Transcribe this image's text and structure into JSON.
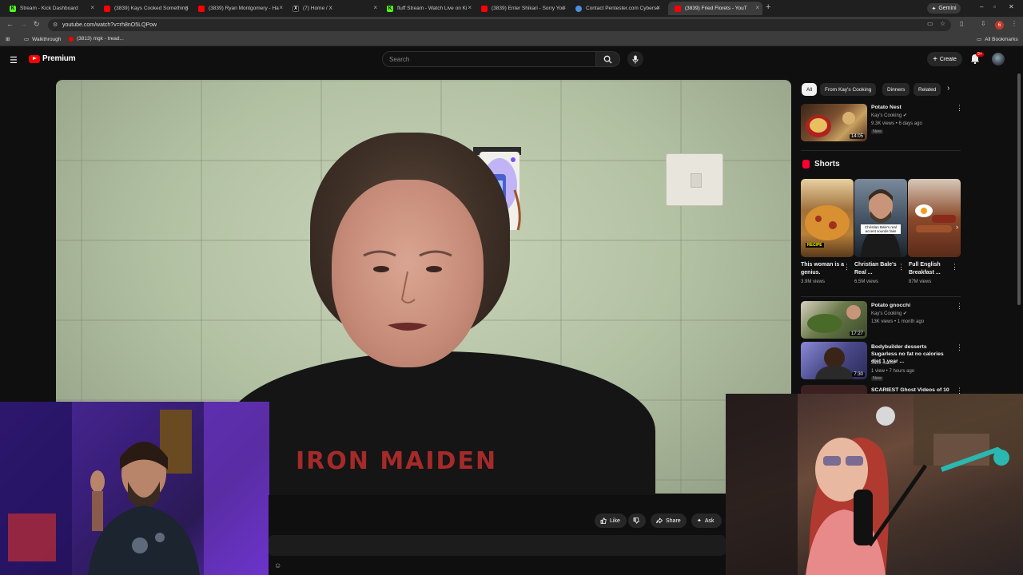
{
  "browser": {
    "tabs": [
      {
        "title": "Stream - Kick Dashboard",
        "favicon": "kick-icon",
        "color": "#53fc18"
      },
      {
        "title": "(3839) Kays Cooked Something",
        "favicon": "youtube-icon",
        "color": "#ff0000"
      },
      {
        "title": "(3839) Ryan Montgomery - Ha",
        "favicon": "youtube-icon",
        "color": "#ff0000"
      },
      {
        "title": "(7) Home / X",
        "favicon": "x-icon",
        "color": "#ffffff"
      },
      {
        "title": "fluff Stream - Watch Live on Ki",
        "favicon": "kick-icon",
        "color": "#53fc18"
      },
      {
        "title": "(3839) Enter Shikari - Sorry You",
        "favicon": "youtube-icon",
        "color": "#ff0000"
      },
      {
        "title": "Contact Pentester.com Cyberse",
        "favicon": "globe-icon",
        "color": "#4a90d9"
      },
      {
        "title": "(3839) Fried Florets - YouT",
        "favicon": "youtube-icon",
        "color": "#ff0000",
        "active": true
      }
    ],
    "gemini_label": "Gemini",
    "url": "youtube.com/watch?v=rh8nO5LQPow",
    "profile_initial": "6",
    "bookmarks": [
      {
        "label": "Walkthrough",
        "icon": "folder-icon"
      },
      {
        "label": "(3813) mgk - tread...",
        "icon": "youtube-icon"
      }
    ],
    "all_bookmarks_label": "All Bookmarks"
  },
  "youtube": {
    "logo_text": "Premium",
    "search_placeholder": "Search",
    "create_label": "Create",
    "notification_count": "9+",
    "actions": {
      "like": "Like",
      "share": "Share",
      "ask": "Ask"
    },
    "chips": [
      "All",
      "From Kay's Cooking",
      "Dinners",
      "Related"
    ],
    "recommendations_top": [
      {
        "title": "Potato Nest",
        "channel": "Kay's Cooking",
        "meta": "9.3K views • 6 days ago",
        "badge": "New",
        "duration": "14:05",
        "thumb_color": "#7a5030"
      }
    ],
    "shorts_label": "Shorts",
    "shorts": [
      {
        "title": "This woman is a genius.",
        "views": "3.9M views",
        "overlay": "RECIPE",
        "thumb_color": "#a0703a"
      },
      {
        "title": "Christian Bale's Real ...",
        "views": "6.5M views",
        "overlay": "Christian Bale's real accent sounds fake",
        "thumb_color": "#3b4a5a"
      },
      {
        "title": "Full English Breakfast ...",
        "views": "87M views",
        "overlay": "",
        "thumb_color": "#8a4a2a"
      }
    ],
    "recommendations_bottom": [
      {
        "title": "Potato gnocchi",
        "channel": "Kay's Cooking",
        "meta": "13K views • 1 month ago",
        "badge": "",
        "duration": "17:27",
        "thumb_color": "#6a7a4a"
      },
      {
        "title": "Bodybuilder desserts Sugarless no fat no calories diet 1 year ...",
        "channel": "Jake Jason",
        "meta": "1 view • 7 hours ago",
        "badge": "New",
        "duration": "7:30",
        "thumb_color": "#4a4a8a"
      },
      {
        "title": "SCARIEST Ghost Videos of 10",
        "channel": "",
        "meta": "",
        "badge": "",
        "duration": "",
        "thumb_color": "#3a2020"
      }
    ]
  },
  "shirt_text": "IRON MAIDEN"
}
